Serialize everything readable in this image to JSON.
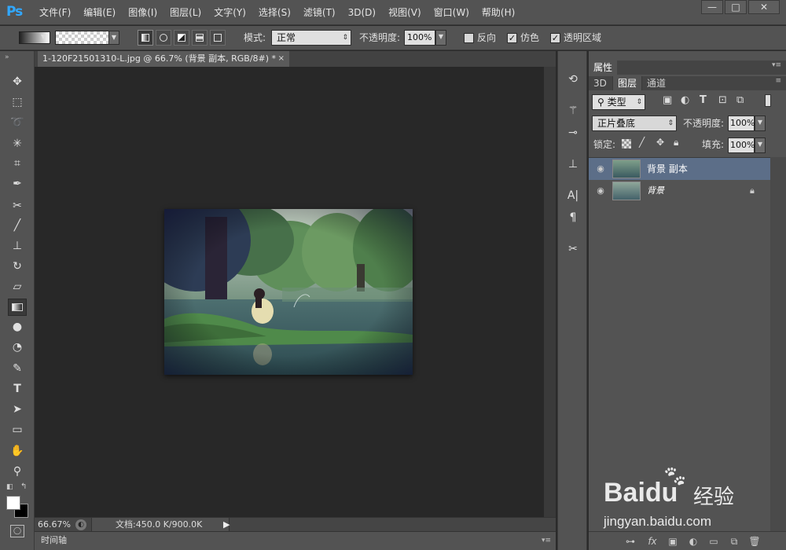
{
  "app": {
    "logo": "Ps"
  },
  "menu": [
    "文件(F)",
    "编辑(E)",
    "图像(I)",
    "图层(L)",
    "文字(Y)",
    "选择(S)",
    "滤镜(T)",
    "3D(D)",
    "视图(V)",
    "窗口(W)",
    "帮助(H)"
  ],
  "window_controls": {
    "minimize": "—",
    "maximize": "□",
    "close": "✕"
  },
  "options": {
    "mode_label": "模式:",
    "mode_value": "正常",
    "opacity_label": "不透明度:",
    "opacity_value": "100%",
    "reverse_label": "反向",
    "dither_label": "仿色",
    "transparency_label": "透明区域",
    "checkbox_mark": "✓"
  },
  "document": {
    "tab_title": "1-120F21501310-L.jpg @ 66.7% (背景 副本, RGB/8#) *",
    "close": "×"
  },
  "status": {
    "zoom": "66.67%",
    "doc_size": "文档:450.0 K/900.0K"
  },
  "timeline": {
    "label": "时间轴"
  },
  "panel": {
    "properties_tab": "属性",
    "tabs": [
      "3D",
      "图层",
      "通道"
    ],
    "filter_kind": "类型",
    "blend_mode": "正片叠底",
    "opacity_label": "不透明度:",
    "opacity_value": "100%",
    "lock_label": "锁定:",
    "fill_label": "填充:",
    "fill_value": "100%",
    "layers": [
      {
        "name": "背景 副本",
        "selected": true,
        "locked": false,
        "italic": false
      },
      {
        "name": "背景",
        "selected": false,
        "locked": true,
        "italic": true
      }
    ]
  },
  "watermark": {
    "brand": "Baidu",
    "brand_cn": "经验",
    "url": "jingyan.baidu.com"
  }
}
